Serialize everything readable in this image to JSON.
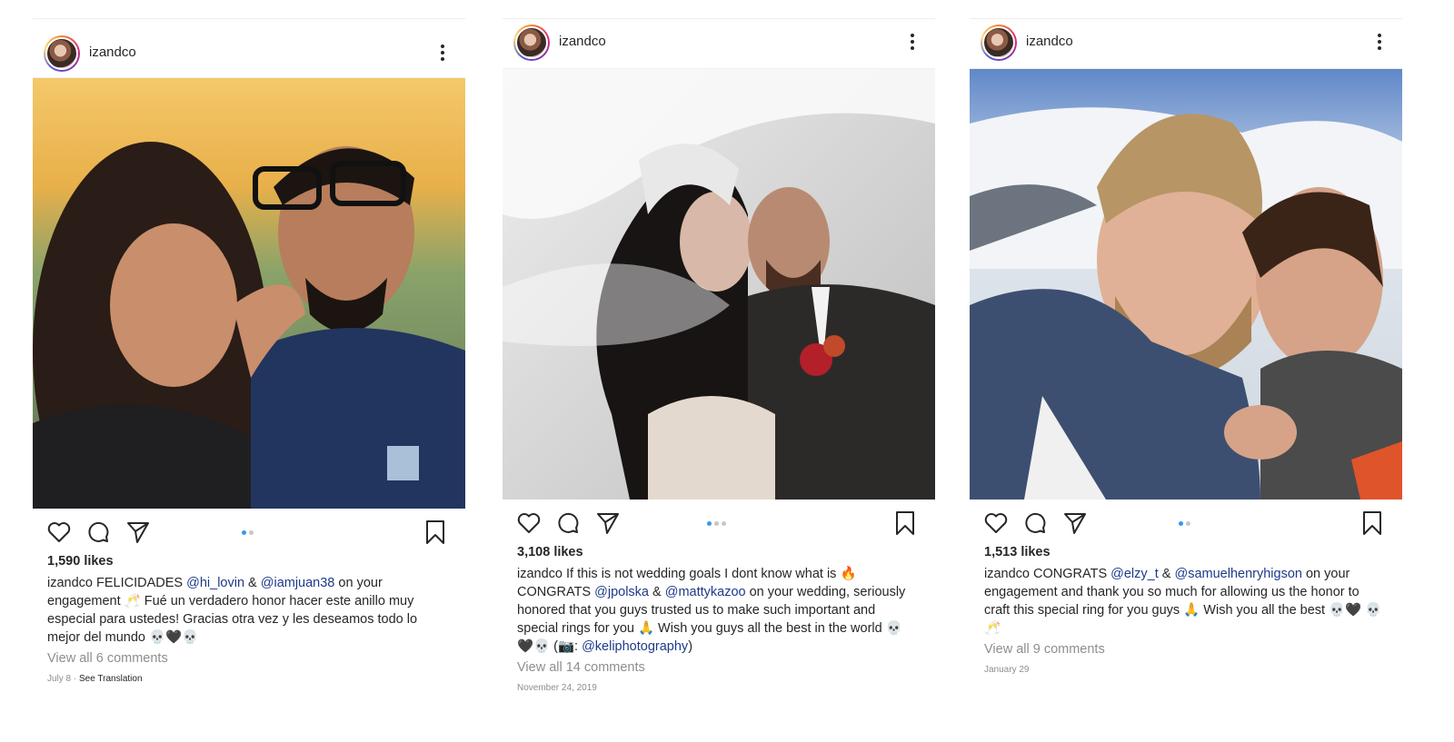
{
  "posts": [
    {
      "username": "izandco",
      "likes": "1,590 likes",
      "caption_user": "izandco",
      "caption_parts": [
        {
          "t": "FELICIDADES  "
        },
        {
          "t": "@hi_lovin",
          "m": true
        },
        {
          "t": " & "
        },
        {
          "t": "@iamjuan38",
          "m": true
        },
        {
          "t": " on your engagement 🥂 Fué un verdadero honor hacer este anillo muy especial para ustedes! Gracias otra vez y les deseamos todo lo mejor del mundo 💀🖤💀"
        }
      ],
      "view_comments": "View all 6 comments",
      "timestamp": "July 8 · ",
      "see_translation": "See Translation",
      "carousel_dots": 2,
      "active_dot": 0
    },
    {
      "username": "izandco",
      "likes": "3,108 likes",
      "caption_user": "izandco",
      "caption_parts": [
        {
          "t": "If this is not wedding goals I dont know what is 🔥 CONGRATS "
        },
        {
          "t": "@jpolska",
          "m": true
        },
        {
          "t": " & "
        },
        {
          "t": "@mattykazoo",
          "m": true
        },
        {
          "t": " on your wedding, seriously honored that you guys trusted us to make such important and special rings for you 🙏 Wish you guys all the best in the world 💀🖤💀 (📷: "
        },
        {
          "t": "@keliphotography",
          "m": true
        },
        {
          "t": ")"
        }
      ],
      "view_comments": "View all 14 comments",
      "timestamp": "November 24, 2019",
      "see_translation": "",
      "carousel_dots": 3,
      "active_dot": 0
    },
    {
      "username": "izandco",
      "likes": "1,513 likes",
      "caption_user": "izandco",
      "caption_parts": [
        {
          "t": "CONGRATS "
        },
        {
          "t": "@elzy_t",
          "m": true
        },
        {
          "t": " & "
        },
        {
          "t": "@samuelhenryhigson",
          "m": true
        },
        {
          "t": " on your engagement and thank you so much for allowing us the honor to craft this special ring for you guys 🙏 Wish you all the best 💀🖤 💀🥂"
        }
      ],
      "view_comments": "View all 9 comments",
      "timestamp": "January 29",
      "see_translation": "",
      "carousel_dots": 2,
      "active_dot": 0
    }
  ],
  "icons": {
    "like": "heart-icon",
    "comment": "comment-bubble-icon",
    "share": "paper-plane-icon",
    "save": "bookmark-icon",
    "more": "vertical-ellipsis-icon"
  },
  "colors": {
    "mention": "#1e3a8a",
    "muted": "#8e8e8e",
    "active_dot": "#3897f0",
    "inactive_dot": "#c7c7c7"
  }
}
